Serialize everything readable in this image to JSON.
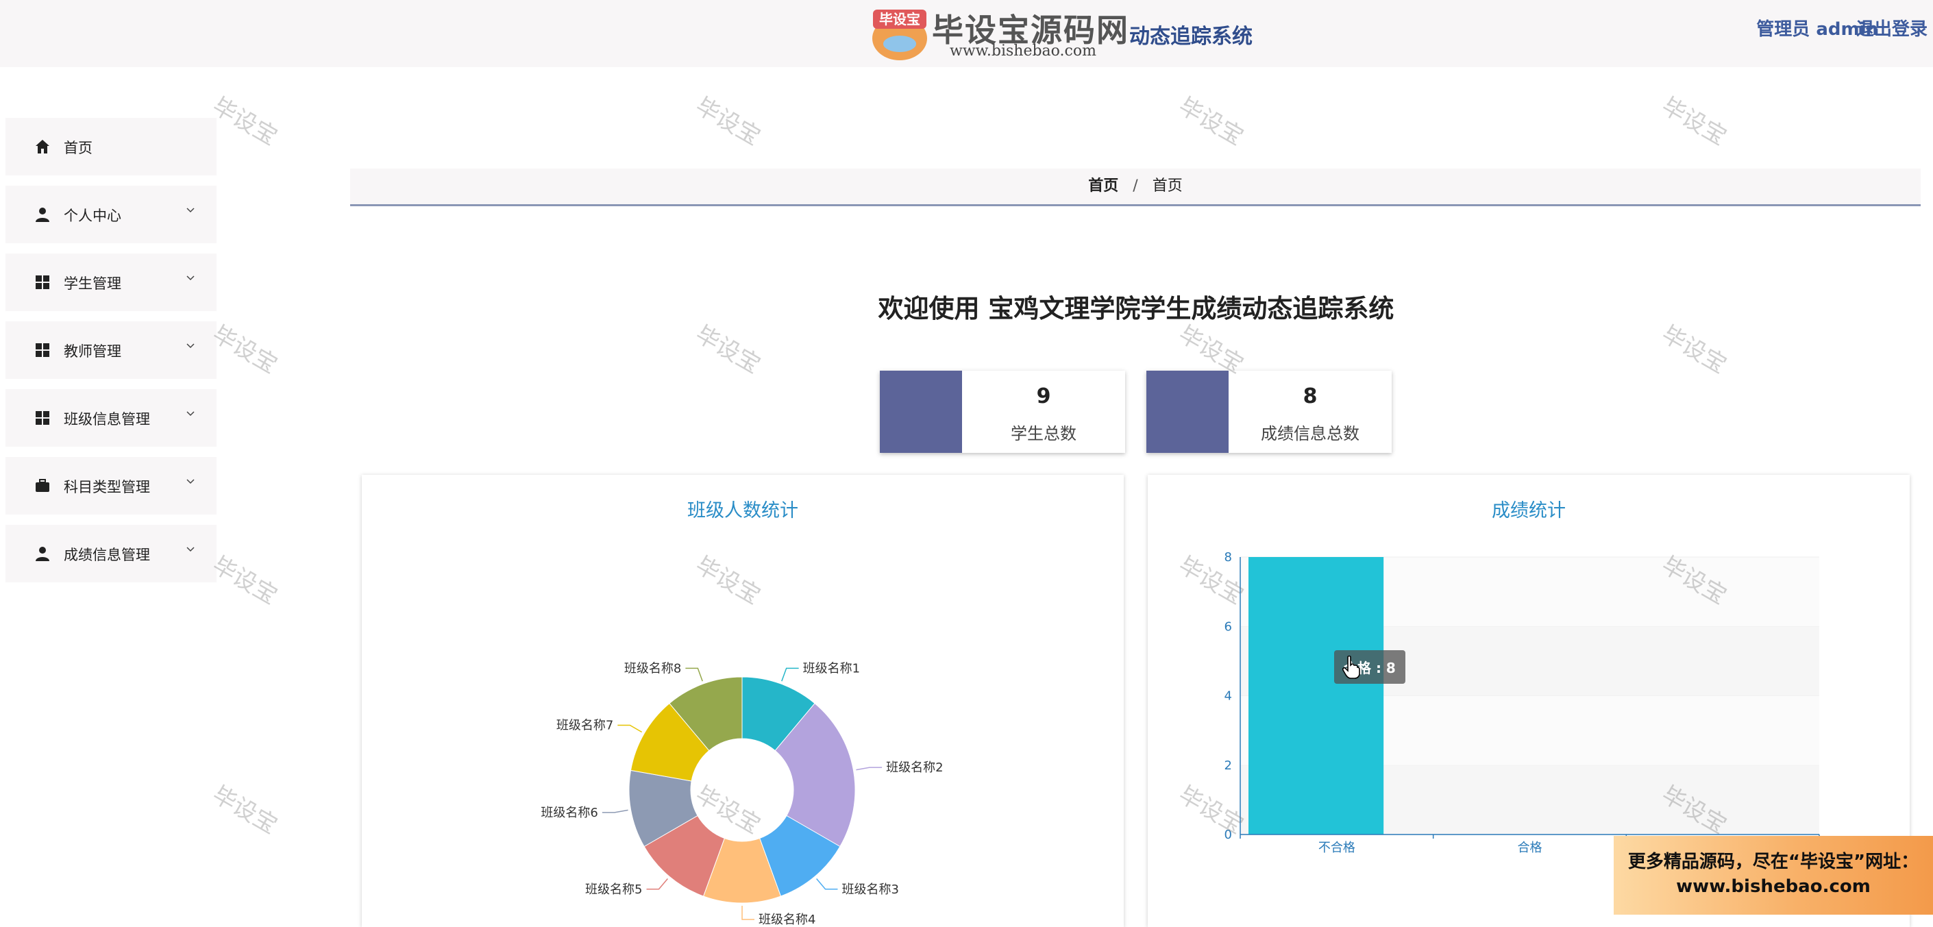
{
  "header": {
    "logo_badge": "毕设宝",
    "logo_text": "毕设宝源码网",
    "logo_url": "www.bishebao.com",
    "system_title": "动态追踪系统",
    "user_role": "管理员",
    "username": "admin",
    "logout": "退出登录"
  },
  "sidebar": {
    "items": [
      {
        "label": "首页",
        "icon": "home-icon",
        "expandable": false
      },
      {
        "label": "个人中心",
        "icon": "user-icon",
        "expandable": true
      },
      {
        "label": "学生管理",
        "icon": "grid-icon",
        "expandable": true
      },
      {
        "label": "教师管理",
        "icon": "grid-icon",
        "expandable": true
      },
      {
        "label": "班级信息管理",
        "icon": "grid-icon",
        "expandable": true
      },
      {
        "label": "科目类型管理",
        "icon": "briefcase-icon",
        "expandable": true
      },
      {
        "label": "成绩信息管理",
        "icon": "user-icon",
        "expandable": true
      }
    ]
  },
  "breadcrumb": {
    "home": "首页",
    "separator": "/",
    "current": "首页"
  },
  "welcome": "欢迎使用 宝鸡文理学院学生成绩动态追踪系统",
  "stats": [
    {
      "value": "9",
      "label": "学生总数"
    },
    {
      "value": "8",
      "label": "成绩信息总数"
    }
  ],
  "colors": {
    "accent": "#5c6499",
    "title_blue": "#2a8dc7",
    "bar": "#22c3d7"
  },
  "watermark": "毕设宝",
  "ad": {
    "line1": "更多精品源码，尽在“毕设宝”网址：",
    "line2": "www.bishebao.com"
  },
  "chart_data": [
    {
      "type": "pie",
      "title": "班级人数统计",
      "donut": true,
      "categories": [
        "班级名称1",
        "班级名称2",
        "班级名称3",
        "班级名称4",
        "班级名称5",
        "班级名称6",
        "班级名称7",
        "班级名称8"
      ],
      "values": [
        1,
        2,
        1,
        1,
        1,
        1,
        1,
        1
      ],
      "colors": [
        "#25b6c9",
        "#b3a3dd",
        "#4fadf2",
        "#ffbf7a",
        "#e07f7a",
        "#8d9ab3",
        "#e6c404",
        "#95a84d"
      ]
    },
    {
      "type": "bar",
      "title": "成绩统计",
      "categories": [
        "不合格",
        "合格"
      ],
      "values": [
        8,
        0
      ],
      "ylim": [
        0,
        8
      ],
      "yticks": [
        0,
        2,
        4,
        6,
        8
      ],
      "tooltip": "合格 : 8",
      "grid": true
    }
  ]
}
